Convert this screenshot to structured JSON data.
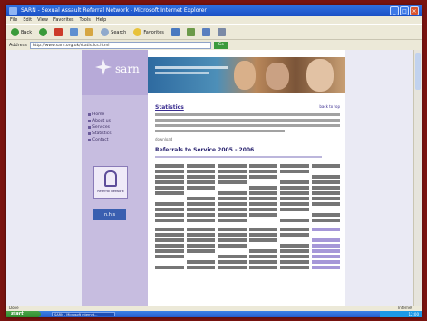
{
  "window": {
    "title": "SARN - Sexual Assault Referral Network - Microsoft Internet Explorer",
    "controls": [
      "minimize-icon",
      "maximize-icon",
      "close-icon"
    ]
  },
  "menu": [
    "File",
    "Edit",
    "View",
    "Favorites",
    "Tools",
    "Help"
  ],
  "toolbar": {
    "back_label": "Back",
    "search_label": "Search",
    "favorites_label": "Favorites"
  },
  "address": {
    "label": "Address",
    "url": "http://www.sarn.org.uk/statistics.html",
    "go_label": "Go"
  },
  "site": {
    "logo_text": "sarn",
    "nav": [
      "Home",
      "About us",
      "Services",
      "Statistics",
      "Contact"
    ],
    "badge_caption": "Referral Network",
    "partner_logo": "n.h.s",
    "heading": "Statistics",
    "top_link": "back to top",
    "small_link": "download",
    "subheading": "Referrals to Service 2005 - 2006"
  },
  "status": {
    "text": "Done",
    "zone": "Internet"
  },
  "taskbar": {
    "start_label": "start",
    "task_label": "SARN - Microsoft Internet...",
    "clock": "12:00"
  },
  "colors": {
    "accent": "#3a2d90",
    "sidebar": "#c7bde0",
    "frame": "#7a1410"
  }
}
